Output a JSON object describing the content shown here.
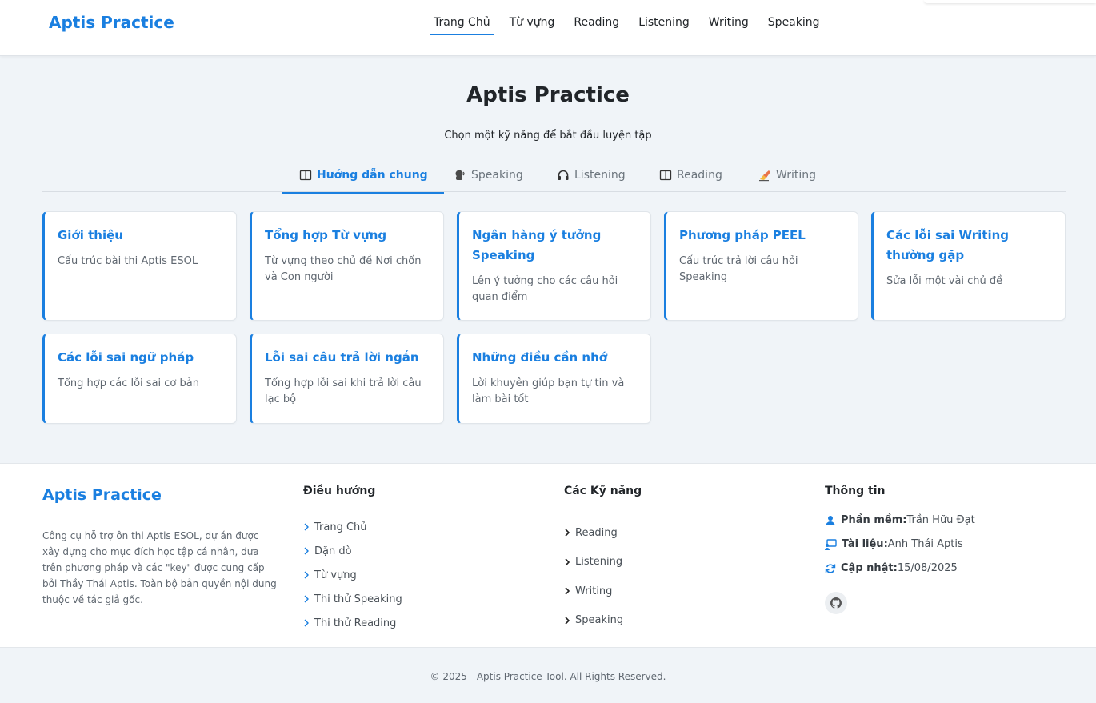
{
  "header": {
    "brand": "Aptis Practice",
    "nav": [
      {
        "label": "Trang Chủ",
        "active": true
      },
      {
        "label": "Từ vựng"
      },
      {
        "label": "Reading"
      },
      {
        "label": "Listening"
      },
      {
        "label": "Writing"
      },
      {
        "label": "Speaking"
      }
    ]
  },
  "main": {
    "title": "Aptis Practice",
    "subtitle": "Chọn một kỹ năng để bắt đầu luyện tập",
    "tabs": [
      {
        "label": "Hướng dẫn chung",
        "icon": "book-icon",
        "active": true
      },
      {
        "label": "Speaking",
        "icon": "speaker-head-icon"
      },
      {
        "label": "Listening",
        "icon": "headphones-icon"
      },
      {
        "label": "Reading",
        "icon": "book-icon"
      },
      {
        "label": "Writing",
        "icon": "writing-hand-icon"
      }
    ],
    "cards": [
      {
        "title": "Giới thiệu",
        "desc": "Cấu trúc bài thi Aptis ESOL"
      },
      {
        "title": "Tổng hợp Từ vựng",
        "desc": "Từ vựng theo chủ đề Nơi chốn và Con người"
      },
      {
        "title": "Ngân hàng ý tưởng Speaking",
        "desc": "Lên ý tưởng cho các câu hỏi quan điểm"
      },
      {
        "title": "Phương pháp PEEL",
        "desc": "Cấu trúc trả lời câu hỏi Speaking"
      },
      {
        "title": "Các lỗi sai Writing thường gặp",
        "desc": "Sửa lỗi một vài chủ đề"
      },
      {
        "title": "Các lỗi sai ngữ pháp",
        "desc": "Tổng hợp các lỗi sai cơ bản"
      },
      {
        "title": "Lỗi sai câu trả lời ngắn",
        "desc": "Tổng hợp lỗi sai khi trả lời câu lạc bộ"
      },
      {
        "title": "Những điều cần nhớ",
        "desc": "Lời khuyên giúp bạn tự tin và làm bài tốt"
      }
    ]
  },
  "footer": {
    "brand": "Aptis Practice",
    "about": "Công cụ hỗ trợ ôn thi Aptis ESOL, dự án được xây dựng cho mục đích học tập cá nhân, dựa trên phương pháp và các \"key\" được cung cấp bởi Thầy Thái Aptis. Toàn bộ bản quyền nội dung thuộc về tác giả gốc.",
    "nav_title": "Điều hướng",
    "nav_links": [
      "Trang Chủ",
      "Dặn dò",
      "Từ vựng",
      "Thi thử Speaking",
      "Thi thử Reading"
    ],
    "skills_title": "Các Kỹ năng",
    "skills_links": [
      "Reading",
      "Listening",
      "Writing",
      "Speaking"
    ],
    "info_title": "Thông tin",
    "info": [
      {
        "label": "Phần mềm:",
        "value": "Trần Hữu Đạt",
        "icon": "user-icon"
      },
      {
        "label": "Tài liệu:",
        "value": "Anh Thái Aptis",
        "icon": "presentation-icon"
      },
      {
        "label": "Cập nhật:",
        "value": "15/08/2025",
        "icon": "refresh-icon"
      }
    ],
    "github_icon": "github-icon",
    "copyright": "© 2025 - Aptis Practice Tool. All Rights Reserved."
  },
  "colors": {
    "accent": "#1a7fe0",
    "background": "#f0f4f8",
    "card_bg": "#ffffff",
    "muted_text": "#5f6770"
  }
}
